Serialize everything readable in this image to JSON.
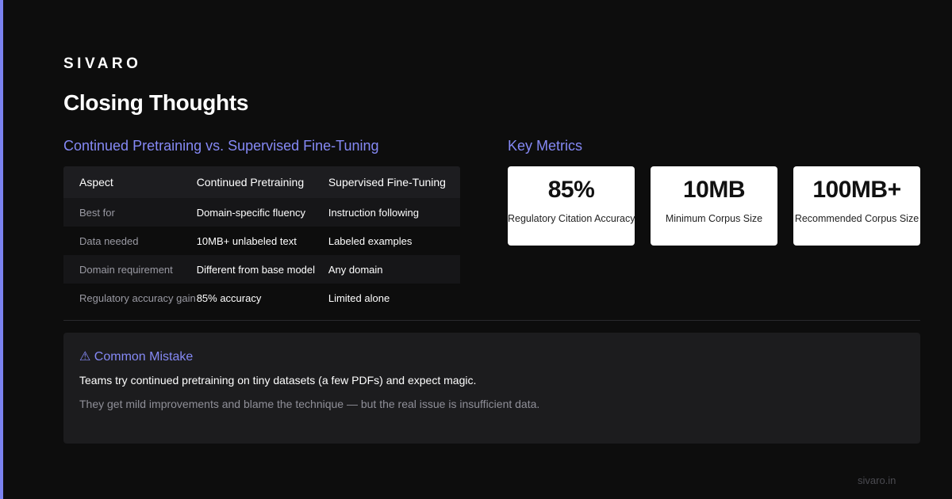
{
  "brand": "SIVARO",
  "title": "Closing Thoughts",
  "comparison": {
    "heading": "Continued Pretraining vs. Supervised Fine-Tuning",
    "columns": [
      "Aspect",
      "Continued Pretraining",
      "Supervised Fine-Tuning"
    ],
    "rows": [
      [
        "Best for",
        "Domain-specific fluency",
        "Instruction following"
      ],
      [
        "Data needed",
        "10MB+ unlabeled text",
        "Labeled examples"
      ],
      [
        "Domain requirement",
        "Different from base model",
        "Any domain"
      ],
      [
        "Regulatory accuracy gain",
        "85% accuracy",
        "Limited alone"
      ]
    ]
  },
  "metrics": {
    "heading": "Key Metrics",
    "cards": [
      {
        "value": "85%",
        "label": "Regulatory Citation Accuracy"
      },
      {
        "value": "10MB",
        "label": "Minimum Corpus Size"
      },
      {
        "value": "100MB+",
        "label": "Recommended Corpus Size"
      }
    ]
  },
  "callout": {
    "icon": "warning-icon",
    "title": "Common Mistake",
    "line1": "Teams try continued pretraining on tiny datasets (a few PDFs) and expect magic.",
    "line2": "They get mild improvements and blame the technique — but the real issue is insufficient data."
  },
  "footer": "sivaro.in",
  "colors": {
    "accent": "#8589f5",
    "background": "#0d0d0d",
    "card": "#ffffff",
    "panel": "#1c1c1e"
  }
}
